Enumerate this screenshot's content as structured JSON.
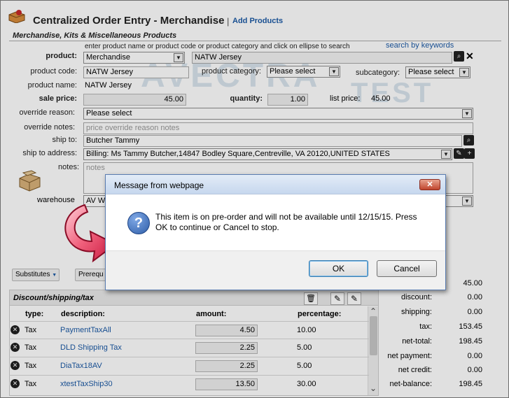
{
  "header": {
    "title": "Centralized Order Entry - Merchandise",
    "separator": "|",
    "add_products_link": "Add Products"
  },
  "section": {
    "title": "Merchandise, Kits & Miscellaneous Products"
  },
  "form": {
    "hint": "enter product name or product code or product category and click on ellipse to search",
    "search_keywords_link": "search by keywords",
    "product": {
      "label": "product:",
      "type_value": "Merchandise",
      "name_value": "NATW Jersey"
    },
    "product_code": {
      "label": "product code:",
      "value": "NATW Jersey"
    },
    "product_category": {
      "label": "product category:",
      "value": "Please select"
    },
    "subcategory": {
      "label": "subcategory:",
      "value": "Please select"
    },
    "product_name": {
      "label": "product name:",
      "value": "NATW Jersey"
    },
    "sale_price": {
      "label": "sale price:",
      "value": "45.00"
    },
    "quantity": {
      "label": "quantity:",
      "value": "1.00"
    },
    "list_price": {
      "label": "list price:",
      "value": "45.00"
    },
    "override_reason": {
      "label": "override reason:",
      "value": "Please select"
    },
    "override_notes": {
      "label": "override notes:",
      "placeholder": "price override reason notes"
    },
    "ship_to": {
      "label": "ship to:",
      "value": "Butcher Tammy"
    },
    "ship_to_address": {
      "label": "ship to address:",
      "value": "Billing: Ms Tammy Butcher,14847 Bodley Square,Centreville, VA 20120,UNITED STATES"
    },
    "notes": {
      "label": "notes:",
      "placeholder": "notes"
    },
    "warehouse": {
      "label": "warehouse",
      "value_fragment": "AV W"
    }
  },
  "buttons": {
    "substitutes": "Substitutes",
    "prerequisites": "Prerequ"
  },
  "dst": {
    "title": "Discount/shipping/tax",
    "columns": {
      "type": "type:",
      "description": "description:",
      "amount": "amount:",
      "percentage": "percentage:"
    },
    "rows": [
      {
        "type": "Tax",
        "description": "PaymentTaxAll",
        "amount": "4.50",
        "percentage": "10.00"
      },
      {
        "type": "Tax",
        "description": "DLD Shipping Tax",
        "amount": "2.25",
        "percentage": "5.00"
      },
      {
        "type": "Tax",
        "description": "DiaTax18AV",
        "amount": "2.25",
        "percentage": "5.00"
      },
      {
        "type": "Tax",
        "description": "xtestTaxShip30",
        "amount": "13.50",
        "percentage": "30.00"
      }
    ]
  },
  "totals": {
    "subtotal_value": "45.00",
    "discount": {
      "label": "discount:",
      "value": "0.00"
    },
    "shipping": {
      "label": "shipping:",
      "value": "0.00"
    },
    "tax": {
      "label": "tax:",
      "value": "153.45"
    },
    "net_total": {
      "label": "net-total:",
      "value": "198.45"
    },
    "net_payment": {
      "label": "net payment:",
      "value": "0.00"
    },
    "net_credit": {
      "label": "net credit:",
      "value": "0.00"
    },
    "net_balance": {
      "label": "net-balance:",
      "value": "198.45"
    }
  },
  "watermark": {
    "brand": "AVECTRA",
    "sub": "TEST"
  },
  "dialog": {
    "title": "Message from webpage",
    "close_glyph": "✕",
    "message": "This item is on pre-order and will not be available until 12/15/15. Press OK to continue or Cancel to stop.",
    "ok_label": "OK",
    "cancel_label": "Cancel",
    "icon_glyph": "?"
  },
  "icons": {
    "close_glyph": "✕",
    "search_glyph": "⌕",
    "trash_glyph": "🗑",
    "edit_glyph": "✎",
    "add_glyph": "+",
    "dropdown_glyph": "▼",
    "scroll_up_glyph": "⌃",
    "scroll_down_glyph": "⌄"
  },
  "colors": {
    "link": "#1c5aa6",
    "dialog_title_bg": "#c6d7ee",
    "arrow": "#e8375a",
    "help_icon": "#2f5ea8"
  }
}
